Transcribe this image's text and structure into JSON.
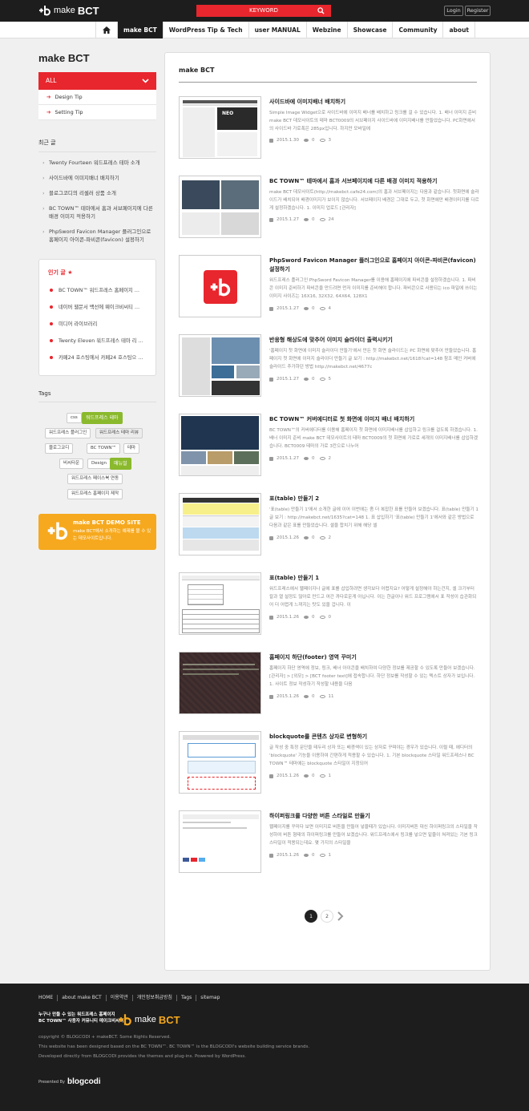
{
  "header": {
    "logo_make": "make",
    "logo_bct": "BCT",
    "search_placeholder": "KEYWORD",
    "login_label": "Login",
    "register_label": "Register"
  },
  "nav": {
    "items": [
      {
        "label": "make BCT",
        "active": true
      },
      {
        "label": "WordPress Tip & Tech"
      },
      {
        "label": "user MANUAL"
      },
      {
        "label": "Webzine"
      },
      {
        "label": "Showcase"
      },
      {
        "label": "Community"
      },
      {
        "label": "about"
      }
    ]
  },
  "sidebar": {
    "title": "make BCT",
    "category_all": "ALL",
    "subcategories": [
      "Design Tip",
      "Setting Tip"
    ],
    "recent_title": "최근 글",
    "recent_posts": [
      "Twenty Fourteen 워드프레스 테마 소개",
      "사이드바에 이미지배너 배치하기",
      "블로그코디의 리셀러 상품 소개",
      "BC TOWN™ 테마에서 홈과 서브페이지에 다른 배경 이미지 적용하기",
      "PhpSword Favicon Manager 플러그인으로 홈페이지 아이콘-파비콘(favicon) 설정하기"
    ],
    "popular_title": "인기 글 ★",
    "popular_posts": [
      "BC TOWN™ 워드프레스 홈페이지 …",
      "네이버 웹문서 백선에 웨이크비씨티 …",
      "미디어 라이브러리",
      "Twenty Eleven 워드프레스 테마 리 …",
      "카페24 호스팅에서 카페24 호스팅으 …"
    ],
    "tags_title": "Tags",
    "tags": [
      "css",
      "워드프레스 테마",
      "워드프레스 플러그인",
      "워드프레스 테마 리뷰",
      "블로그코디",
      "BC TOWN™",
      "테마",
      "비씨타운",
      "Design",
      "매뉴얼",
      "워드프레스 페이스북 연동",
      "워드프레스 홈페이지 제작"
    ],
    "demo_title": "make BCT DEMO SITE",
    "demo_desc": "make BCT에서 소개하는 예제를 볼 수 있는 데모사이트입니다."
  },
  "main": {
    "title": "make BCT",
    "posts": [
      {
        "title": "사이드바에 이미지배너 배치하기",
        "excerpt": "Simple Image Widget으로 사이드바에 이미지 배너를 배치하고 링크를 걸 수 있습니다. 1. 배너 이미지 준비 make BCT 데모사이트의 테마 BCT0009의 서브페이지 사이드바에 이미지배너를 만들었습니다. PC화면에서의 사이드바 가로폭은 285px입니다. 하지만 모바일에",
        "date": "2015.1.30",
        "comments": "0",
        "views": "3"
      },
      {
        "title": "BC TOWN™ 테마에서 홈과 서브페이지에 다른 배경 이미지 적용하기",
        "excerpt": "make BCT 데모사이트(http://makebct.cafe24.com)의 홈과 서브페이지는 다음과 같습니다. 첫화면에 슬라이드가 배치되어 배경이미지가 보이지 않습니다. 서브페이지 배경은 그대로 두고, 첫 화면에만 배경이미지를 다르게 설정하겠습니다. 1. 이미지 업로드 [관리자]",
        "date": "2015.1.27",
        "comments": "0",
        "views": "24"
      },
      {
        "title": "PhpSword Favicon Manager 플러그인으로 홈페이지 아이콘-파비콘(favicon) 설정하기",
        "excerpt": "워드프레스 플러그인 PhpSword Favicon Manager를 이용해 홈페이지에 파비콘을 설정하겠습니다. 1. 파비콘 이미지 준비하기 파비콘을 만드려면 먼저 이미지를 준비해야 합니다. 파비콘으로 사용되는 ico 파일에 쓰이는 이미지 사이즈는 16X16, 32X32, 64X64, 128X1",
        "date": "2015.1.27",
        "comments": "0",
        "views": "4"
      },
      {
        "title": "반응형 해상도에 맞추어 이미지 슬라이더 출력시키기",
        "excerpt": "'홈페이지 첫 화면에 이미지 슬라이더 만들기'에서 만든 첫 화면 슬라이드는 PC 화면에 맞추어 만들었습니다. 홈페이지 첫 화면에 이미지 슬라이더 만들기 글 보기 : http://makebct.net/1618?cat=148 참조 메인 커버에 슬라이드 추가하던 방법 http://makebct.net/4677c",
        "date": "2015.1.27",
        "comments": "0",
        "views": "5"
      },
      {
        "title": "BC TOWN™ 커버에디터로 첫 화면에 이미지 배너 배치하기",
        "excerpt": "BC TOWN™의 커버에디터를 이용해 홈페이지 첫 화면에 이미지배너를 삽입하고 링크를 걸도록 하겠습니다. 1. 배너 이미지 준비 make BCT 데모사이트의 테마 BCT0009의 첫 화면에 가로로 세개의 이미지배너를 삽입하겠습니다. BCT0009 테마의 가로 3칸으로 나누어",
        "date": "2015.1.27",
        "comments": "0",
        "views": "2"
      },
      {
        "title": "표(table) 만들기 2",
        "excerpt": "'표(table) 만들기 1'에서 소개한 글에 이어 이번에는 좀 더 복잡한 표를 만들어 보겠습니다. 표(table) 만들기 1 글 보기 : http://makebct.net/1635?cat=148 1. 표 삽입하기 '표(table) 만들기 1'에서와 같은 방법으로 다음과 같은 표를 만들었습니다. 셀을 합치기 위해 해당 셀",
        "date": "2015.1.26",
        "comments": "0",
        "views": "2"
      },
      {
        "title": "표(table) 만들기 1",
        "excerpt": "워드프레스에서 웹페이지나 글에 표를 삽입하려면 생각보다 어렵지요? 어떻게 설정해야 하는건지, 셀 크기부터 칼과 열 설정도 많아로 만드고 여간 까다로운게 아닙니다. 이는 한글이나 워드 프로그램에서 표 작성이 습관화되어 더 어렵게 느껴지는 탓도 있을 겁니다. 이",
        "date": "2015.1.26",
        "comments": "0",
        "views": "0"
      },
      {
        "title": "홈페이지 하단(footer) 영역 꾸미기",
        "excerpt": "홈페이지 하단 영역에 정보, 링크, 배너 아이콘을 배치하여 다양한 정보를 제공할 수 있도록 만들어 보겠습니다. [관리자] > [외모] > [BCT footer text]에 접속합니다. 하단 정보를 작성할 수 있는 텍스트 상자가 보입니다. 1. 사이트 정보 작성하기 작성할 내용을 다음",
        "date": "2015.1.26",
        "comments": "0",
        "views": "11"
      },
      {
        "title": "blockquote를 콘텐츠 상자로 변형하기",
        "excerpt": "글 작성 중 특정 문단을 테두리 상자 또는 배경색이 있는 상자로 꾸며야는 경우가 있습니다. 이럴 때, 에디터의 'blockquote' 기능을 이용하여 간편하게 적용할 수 있습니다. 1. 기본 blockquote 스타일 워드프레스나 BC TOWN™ 테마에는 blockquote 스타일이 지정되어",
        "date": "2015.1.26",
        "comments": "0",
        "views": "1"
      },
      {
        "title": "하이퍼링크를 다양한 버튼 스타일로 만들기",
        "excerpt": "웹페이지를 꾸미다 보면 이미지로 버튼을 만들어 넣을때가 있습니다. 이미지버튼 대신 하이퍼링크의 스타일을 작성하여 버튼 형태의 하이퍼링크를 만들어 보겠습니다. 워드프레스에서 링크를 넣으면 밑줄이 쳐져있는 기본 링크 스타일이 적용되는데요. 몇 가지의 스타일을",
        "date": "2015.1.26",
        "comments": "0",
        "views": "1"
      }
    ],
    "pages": [
      "1",
      "2"
    ]
  },
  "footer": {
    "links": [
      "HOME",
      "about make BCT",
      "이용약관",
      "개인정보취급방침",
      "Tags",
      "sitemap"
    ],
    "slogan1": "누구나 만들 수 있는 워드프레스 홈페이지",
    "slogan2": "BC TOWN™ 사용자 커뮤니티 메이크비씨티",
    "copy1": "copyright © BLOGCODI + makeBCT. Some Rights Reserved.",
    "copy2": "This website has been designed based on the BC TOWN™. BC TOWN™ is the BLOGCODI's website building service brands.",
    "copy3": "Developed directly from BLOGCODI provides the themes and plug-ins. Powered by WordPress.",
    "presented": "Presented By",
    "blogcodi": "blogcodi"
  },
  "colors": {
    "accent": "#e8262d",
    "demo": "#f6a91e",
    "tag_green": "#8ab92d",
    "dark": "#1d1d1d"
  }
}
